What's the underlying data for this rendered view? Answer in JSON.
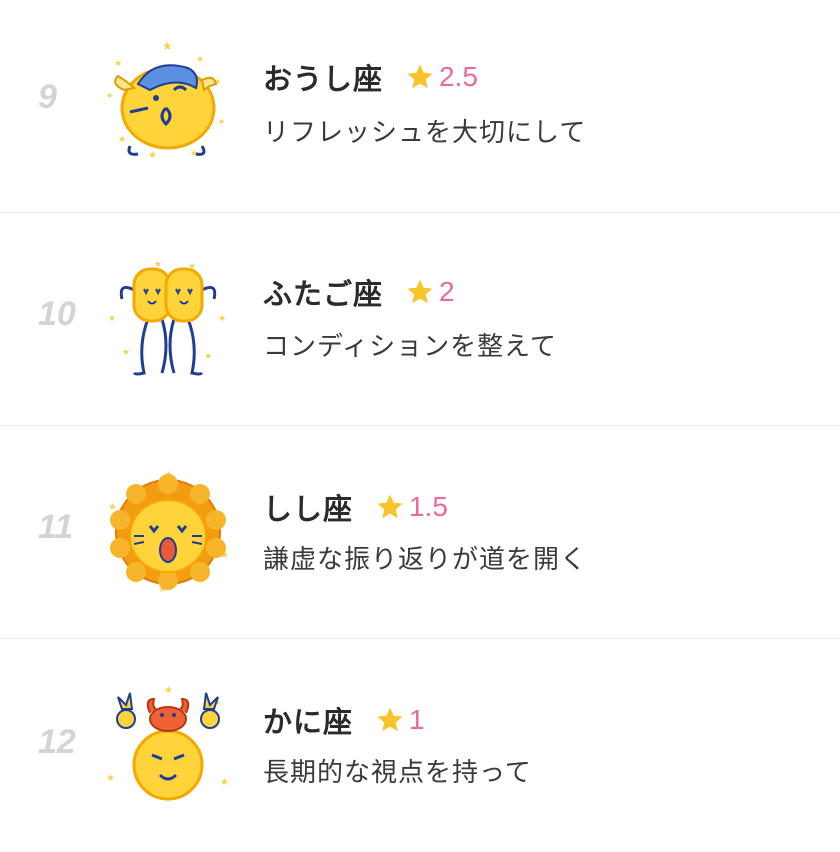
{
  "rankings": [
    {
      "rank": "9",
      "sign": "おうし座",
      "score": "2.5",
      "message": "リフレッシュを大切にして",
      "character_icon": "taurus-character-icon"
    },
    {
      "rank": "10",
      "sign": "ふたご座",
      "score": "2",
      "message": "コンディションを整えて",
      "character_icon": "gemini-character-icon"
    },
    {
      "rank": "11",
      "sign": "しし座",
      "score": "1.5",
      "message": "謙虚な振り返りが道を開く",
      "character_icon": "leo-character-icon"
    },
    {
      "rank": "12",
      "sign": "かに座",
      "score": "1",
      "message": "長期的な視点を持って",
      "character_icon": "cancer-character-icon"
    }
  ],
  "colors": {
    "score": "#ec6a9a",
    "star": "#f7c52b",
    "rank": "#d4d4d4",
    "character_yellow": "#ffd43a",
    "character_outline": "#1f3d94"
  }
}
